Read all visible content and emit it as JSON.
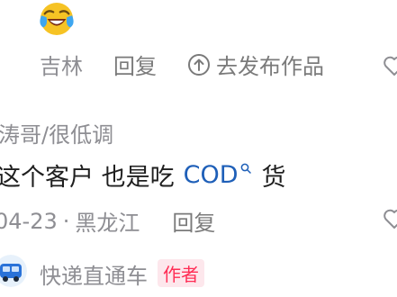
{
  "top_comment": {
    "emoji": "tears-of-joy-emoji",
    "location": "吉林",
    "reply_label": "回复",
    "goto_label": "去发布作品"
  },
  "comment": {
    "username": "涛哥/很低调",
    "text_before": "这个客户 也是吃",
    "link_word": "COD",
    "text_after": "货",
    "date": "04-23",
    "separator": "·",
    "region": "黑龙江",
    "reply_label": "回复"
  },
  "next_comment": {
    "author": "快递直通车",
    "badge": "作者"
  },
  "colors": {
    "meta": "#8e8e93",
    "link": "#1e5fb8",
    "badge_text": "#ff2d55",
    "badge_bg": "#fde7ec"
  }
}
